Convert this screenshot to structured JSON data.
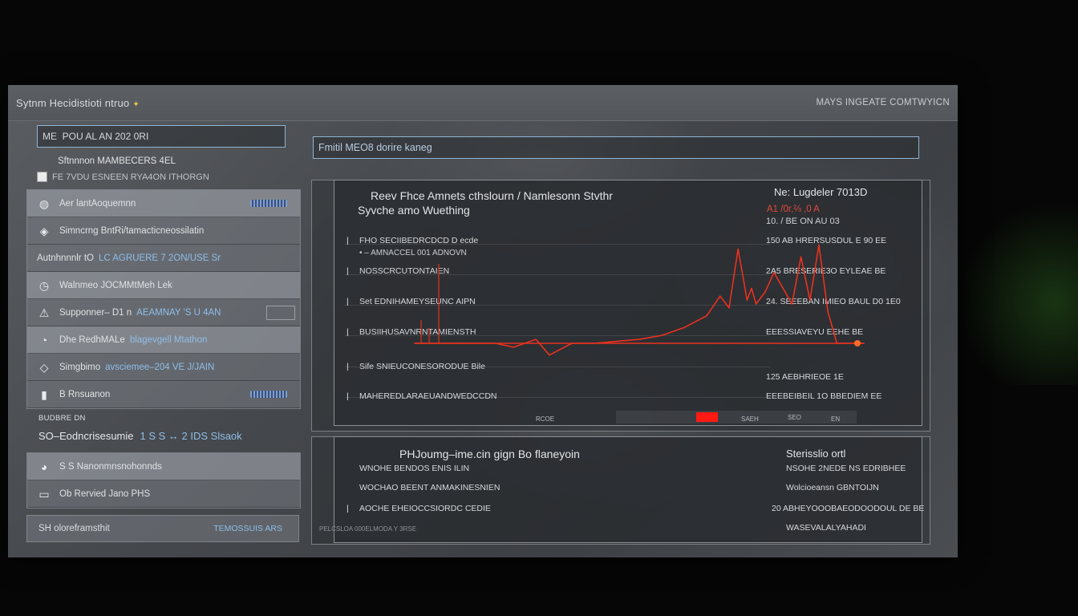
{
  "app": {
    "title": "Sytnm Hecidistioti ntruo",
    "title_spark": "✦",
    "title_right": "MAYS INGEATE COMTWYICN"
  },
  "sidebar": {
    "field_value": "ME  POU AL AN 202 0RI",
    "subtitle": "Sftnnnon MAMBECERS 4EL",
    "subtitle2": "FE 7VDU ESNEEN RYA4ON ITHORGN",
    "items": [
      {
        "icon": "globe-icon",
        "glyph": "◍",
        "label": "Aer lantAoquemnn",
        "accent": "",
        "badge": true,
        "highlight": true
      },
      {
        "icon": "tag-icon",
        "glyph": "◈",
        "label": "Simncrng BntRi/tamacticneossilatin",
        "accent": "",
        "badge": false,
        "highlight": false
      },
      {
        "icon": "",
        "glyph": "",
        "label": "Autnhnnnlr tO",
        "accent": "LC AGRUERE 7 2ON/USE Sr",
        "badge": false,
        "highlight": false
      },
      {
        "icon": "clock-icon",
        "glyph": "◷",
        "label": "Walnmeo  JOCMMtMeh Lek",
        "accent": "",
        "badge": false,
        "highlight": true
      },
      {
        "icon": "warning-icon",
        "glyph": "⚠",
        "label": "Supponner– D1 n",
        "accent": "AEAMNAY 'S U 4AN",
        "badge": false,
        "highlight": false,
        "box": true
      },
      {
        "icon": "user-icon",
        "glyph": "◔",
        "label": "Dhe RedhMALe",
        "accent": "blagevgell Mtathon",
        "badge": false,
        "highlight": true
      },
      {
        "icon": "diamond-icon",
        "glyph": "◇",
        "label": "Simgbimo",
        "accent": "avsciemee–204 VE J/JAIN",
        "badge": false,
        "highlight": false
      },
      {
        "icon": "phone-icon",
        "glyph": "▮",
        "label": "B Rnsuanon",
        "accent": "",
        "badge": true,
        "highlight": false
      }
    ],
    "section_label": "BUDBRE DN",
    "section_title": "SO–Eodncrisesumie",
    "section_accent": "1 S S ↔ 2 IDS Slsaok",
    "items2": [
      {
        "icon": "user-icon",
        "glyph": "◕",
        "label": "S S Nanonmnsnohonnds",
        "highlight": true
      },
      {
        "icon": "file-icon",
        "glyph": "▭",
        "label": "Ob Rervied Jano  PHS",
        "highlight": false
      }
    ],
    "footer_label": "SH oloreframsthit",
    "footer_accent": "TEMOSSUIS ARS"
  },
  "main": {
    "search_value": "Fmitil MEO8 dorire kaneg",
    "chart": {
      "title": "Reev Fhce Amnets cthslourn / Namlesonn Stvthr",
      "subtitle": "Syvche amo  Wuething",
      "right_title": "Ne: Lugdeler 7013D",
      "right_red": "A1 /0r,⅔ ,0 A",
      "right_sub": "10. / BE ON AU 03",
      "rows": [
        {
          "label": "FHO SECIIBEDRCDCD D ecde",
          "value": "150 AB HRERSUSDUL E 90 EE"
        },
        {
          "label": "NOSSCRCUTONTAIEN",
          "value": "2A5 BRESERIE3O EYLEAE BE"
        },
        {
          "label": "Set EDNIHAMEYSEUNC AIPN",
          "value": "24. SEEEBAN IMIEO BAUL D0 1E0"
        },
        {
          "label": "BUSIIHUSAVNRNTAMIENSTH",
          "value": "EEESSIAVEYU EEHE BE"
        },
        {
          "label": "Sife SNIEUCONESORODUE Bile",
          "value": "125 AEBHRIEOE 1E"
        },
        {
          "label": "MAHEREDLARAEUANDWEDCCDN",
          "value": "EEEBEIBEIL 1O BBEDIEM EE"
        }
      ],
      "row_sub": "• – AMNACCEL 001 ADNOVN",
      "bottom_small": [
        "RCOE",
        "SAEH",
        "SEO",
        "EN"
      ],
      "chart_data": {
        "type": "line",
        "title": "Reev Fhce Amnets cthslourn / Namlesonn Stvthr",
        "series": [
          {
            "x": [
              0,
              10,
              18,
              22,
              27,
              30,
              35,
              40,
              45,
              50,
              55,
              60,
              65,
              68,
              70,
              72,
              74,
              75,
              76,
              78,
              80,
              82,
              84,
              86,
              88,
              90,
              92,
              94,
              95,
              100
            ],
            "y": [
              0,
              0,
              0,
              -1,
              1,
              -3,
              0,
              0,
              0.5,
              1,
              2,
              4,
              7,
              12,
              9,
              24,
              11,
              14,
              10,
              13,
              18,
              14,
              10,
              22,
              11,
              25,
              8,
              0,
              0,
              0
            ]
          }
        ],
        "ylim": [
          -5,
          30
        ]
      }
    },
    "panel2": {
      "title": "PHJoumg–ime.cin gign Bo flaneyoin",
      "right_title": "Sterisslio ortl",
      "rows": [
        {
          "label": "WNOHE BENDOS ENIS ILIN",
          "value": "NSOHE 2NEDE NS EDRIBHEE",
          "tick": false
        },
        {
          "label": "WOCHAO BEENT ANMAKINESNIEN",
          "value": "Wolcioeansn GBNTOIJN",
          "tick": false
        },
        {
          "label": "AOCHE EHEIOCCSIORDC CEDIE",
          "value": "20 ABHEYOOOBAEODOODOUL DE BE",
          "tick": true
        },
        {
          "label": "",
          "value": "WASEVALALYAHADI",
          "tick": false
        }
      ],
      "footer": "PELCSLOA 000ELMODA Y 3RSE"
    }
  },
  "colors": {
    "accent_blue": "#8fbde8",
    "line_red": "#e8321f",
    "window_bg": "#4a4d51"
  }
}
